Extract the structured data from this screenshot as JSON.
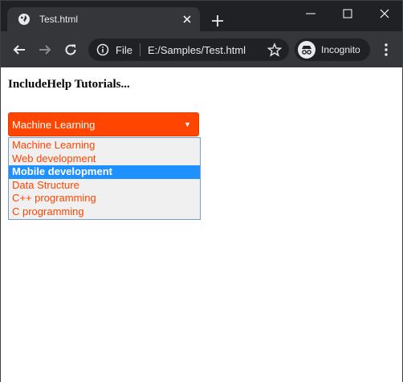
{
  "browser": {
    "tab": {
      "title": "Test.html",
      "favicon": "globe-icon"
    },
    "toolbar": {
      "scheme_label": "File",
      "url": "E:/Samples/Test.html",
      "profile_label": "Incognito"
    }
  },
  "page": {
    "heading": "IncludeHelp Tutorials...",
    "select": {
      "selected_value": "Machine Learning",
      "highlighted_option": "Mobile development",
      "options": [
        "Machine Learning",
        "Web development",
        "Mobile development",
        "Data Structure",
        "C++ programming",
        "C programming"
      ]
    }
  },
  "colors": {
    "select_background": "#ff4500",
    "option_text": "#ff4500",
    "highlight": "#1e90ff",
    "chrome_dark": "#202124",
    "chrome_toolbar": "#35363a"
  }
}
